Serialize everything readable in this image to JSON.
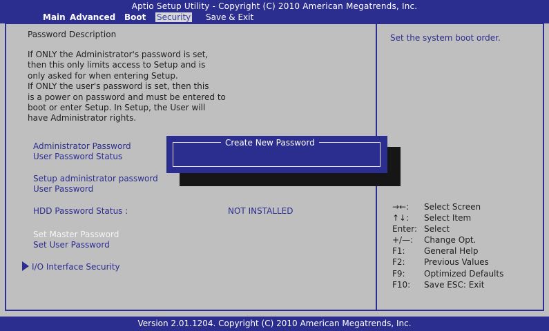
{
  "title": "Aptio Setup Utility - Copyright (C) 2010 American Megatrends, Inc.",
  "tabs": [
    "Main",
    "Advanced",
    "Boot",
    "Security",
    "Save & Exit"
  ],
  "description_heading": "Password Description",
  "description_lines": [
    "If ONLY the Administrator's password is set,",
    "then this only limits access to Setup and is",
    "only asked for when entering Setup.",
    "If ONLY the user's password is set, then this",
    "is a power on password and must be entered to",
    "boot or enter Setup. In Setup, the User will",
    "have Administrator rights."
  ],
  "items": {
    "admin_password": "Administrator Password",
    "user_password_status": "User Password Status",
    "setup_admin_password": "Setup administrator password",
    "user_password": "User Password",
    "hdd_status_label": "HDD Password Status :",
    "hdd_status_value": "NOT INSTALLED",
    "set_master_password": "Set Master Password",
    "set_user_password": "Set User Password",
    "io_interface_security": "I/O Interface Security"
  },
  "dialog": {
    "title": "Create New Password",
    "value": ""
  },
  "help_text": "Set the system boot order.",
  "keys": [
    {
      "key": "→←:",
      "desc": "Select Screen"
    },
    {
      "key": "↑↓:",
      "desc": "Select Item"
    },
    {
      "key": "Enter:",
      "desc": "Select"
    },
    {
      "key": "+/—:",
      "desc": "Change Opt."
    },
    {
      "key": "F1:",
      "desc": "General Help"
    },
    {
      "key": "F2:",
      "desc": "Previous Values"
    },
    {
      "key": "F9:",
      "desc": "Optimized Defaults"
    },
    {
      "key": "F10:",
      "desc": "Save   ESC: Exit"
    }
  ],
  "footer": "Version 2.01.1204. Copyright (C) 2010 American Megatrends, Inc.",
  "colors": {
    "accent": "#2b2d8f",
    "background": "#bfbfbf",
    "shadow": "#161616"
  }
}
